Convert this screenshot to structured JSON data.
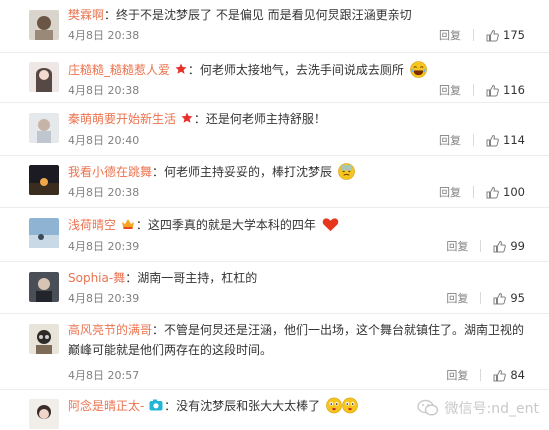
{
  "comments": [
    {
      "name": "樊霖啊",
      "text": "：终于不是沈梦辰了  不是偏见   而是看见何炅跟汪涵更亲切",
      "time": "4月8日 20:38",
      "reply": "回复",
      "likes": "175",
      "badge": "",
      "emoji": ""
    },
    {
      "name": "庄糙糙_糙糙惹人爱",
      "text": "：何老师太接地气，去洗手间说成去厕所",
      "time": "4月8日 20:38",
      "reply": "回复",
      "likes": "116",
      "badge": "star-badge-icon",
      "emoji": "laughing-emoji-icon"
    },
    {
      "name": "秦萌萌要开始新生活",
      "text": "：还是何老师主持舒服！",
      "time": "4月8日 20:40",
      "reply": "回复",
      "likes": "114",
      "badge": "star-badge-icon",
      "emoji": ""
    },
    {
      "name": "我看小德在跳舞",
      "text": "：何老师主持妥妥的，棒打沈梦辰",
      "time": "4月8日 20:38",
      "reply": "回复",
      "likes": "100",
      "badge": "",
      "emoji": "sweat-emoji-icon"
    },
    {
      "name": "浅荷晴空",
      "text": "：这四季真的就是大学本科的四年",
      "time": "4月8日 20:39",
      "reply": "回复",
      "likes": "99",
      "badge": "member-badge-icon",
      "emoji": "heart-icon"
    },
    {
      "name": "Sophia-舞",
      "text": "：湖南一哥主持，杠杠的",
      "time": "4月8日 20:39",
      "reply": "回复",
      "likes": "95",
      "badge": "",
      "emoji": ""
    },
    {
      "name": "高风亮节的满哥",
      "text": "：不管是何炅还是汪涵，他们一出场，这个舞台就镇住了。湖南卫视的巅峰可能就是他们两存在的这段时间。",
      "time": "4月8日 20:57",
      "reply": "回复",
      "likes": "84",
      "badge": "",
      "emoji": ""
    },
    {
      "name": "阿念是晴正太-",
      "text": "：没有沈梦辰和张大大太棒了",
      "time": "",
      "reply": "",
      "likes": "",
      "badge": "camera-badge-icon",
      "emoji": "wink-emoji-icon"
    }
  ],
  "watermark": "微信号:nd_ent",
  "colors": {
    "name": "#eb7350",
    "meta": "#808080",
    "text": "#333333"
  }
}
